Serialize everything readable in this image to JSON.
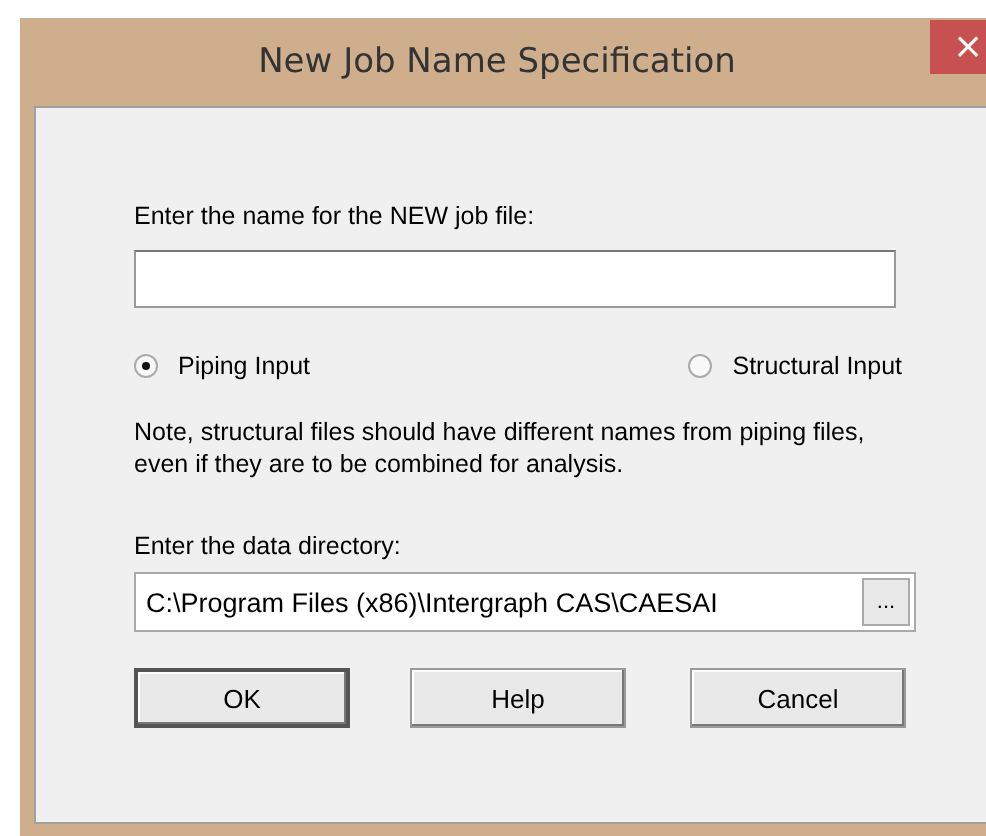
{
  "window": {
    "title": "New Job Name Specification",
    "close": "×"
  },
  "name_field": {
    "label": "Enter the name for the NEW job file:"
  },
  "radios": [
    {
      "label": "Piping Input",
      "selected": true
    },
    {
      "label": "Structural Input",
      "selected": false
    }
  ],
  "note": "Note, structural files should have different names from piping files, even if they are to be combined for analysis.",
  "directory": {
    "label": "Enter the data directory:",
    "value": "C:\\Program Files (x86)\\Intergraph CAS\\CAESAI",
    "browse": "..."
  },
  "buttons": [
    {
      "label": "OK",
      "default": true
    },
    {
      "label": "Help",
      "default": false
    },
    {
      "label": "Cancel",
      "default": false
    }
  ]
}
